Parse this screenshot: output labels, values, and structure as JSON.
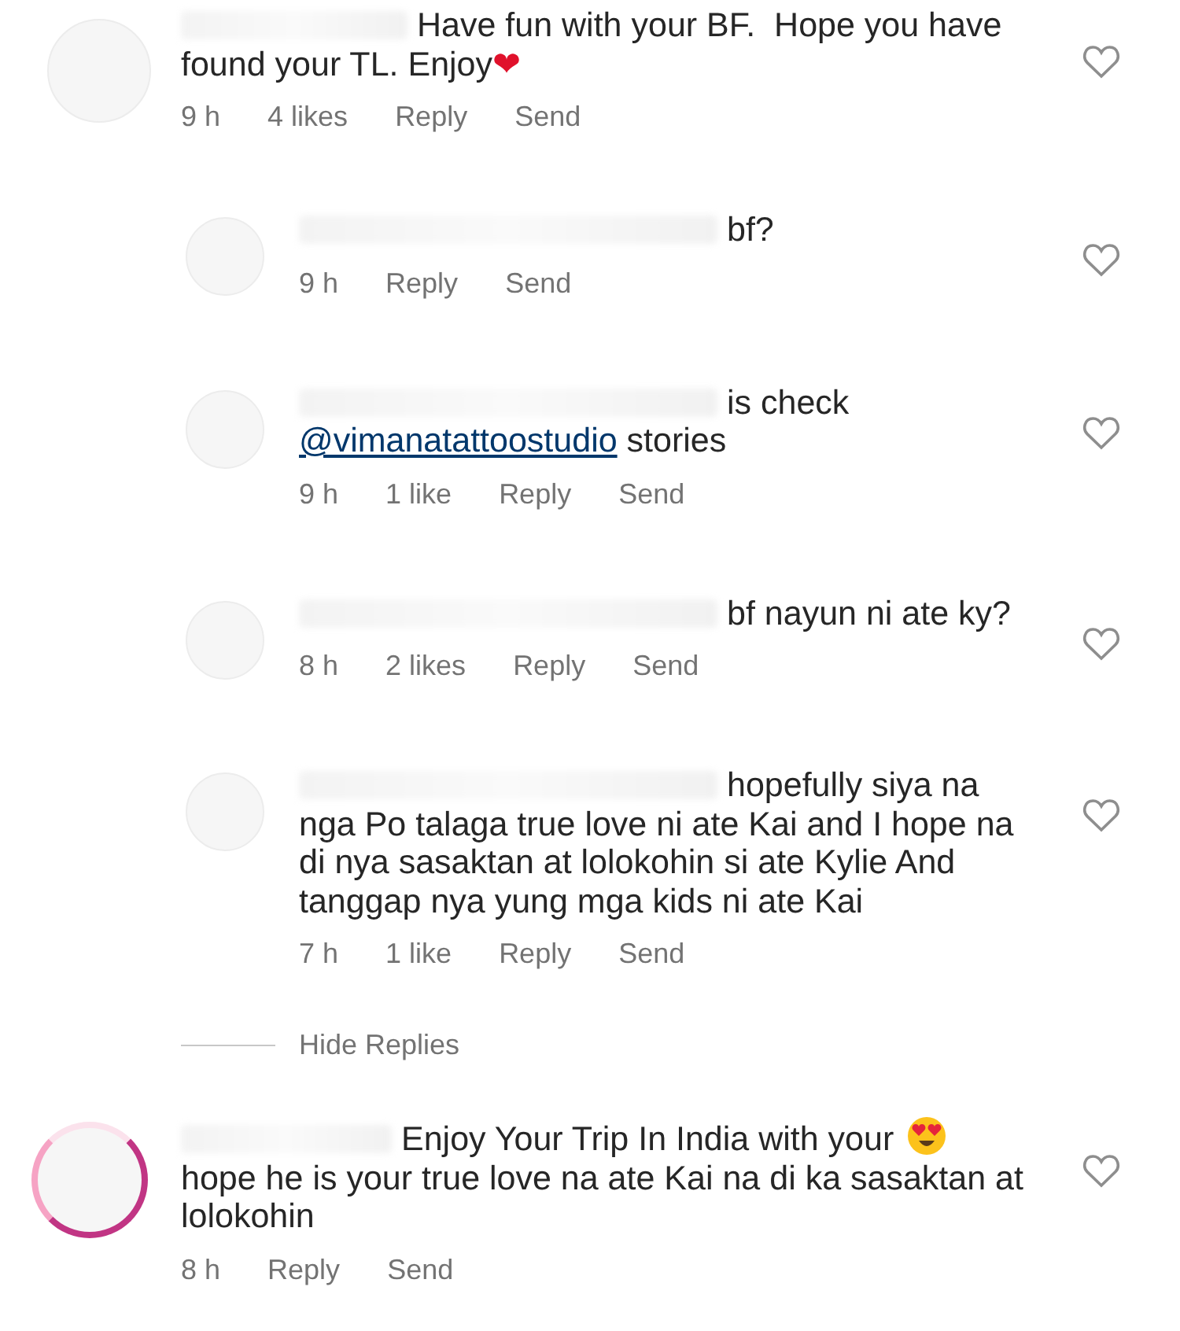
{
  "comments": [
    {
      "has_story": false,
      "liked": false,
      "text": [
        {
          "kind": "text",
          "text": "Have fun with your BF.  Hope you have found your TL. Enjoy❤"
        }
      ],
      "time": "9 h",
      "likes": "4 likes",
      "reply": "Reply",
      "send": "Send",
      "replies": [
        {
          "has_story": false,
          "liked": false,
          "text": [
            {
              "kind": "text",
              "text": "bf?"
            }
          ],
          "time": "9 h",
          "reply": "Reply",
          "send": "Send"
        },
        {
          "has_story": false,
          "liked": false,
          "text": [
            {
              "kind": "text",
              "text": "is check"
            },
            {
              "kind": "mention",
              "text": "@vimanatattoostudio"
            },
            {
              "kind": "text",
              "text": "stories"
            }
          ],
          "time": "9 h",
          "likes": "1 like",
          "reply": "Reply",
          "send": "Send"
        },
        {
          "has_story": false,
          "liked": false,
          "text": [
            {
              "kind": "text",
              "text": "bf nayun ni ate ky?"
            }
          ],
          "time": "8 h",
          "likes": "2 likes",
          "reply": "Reply",
          "send": "Send"
        },
        {
          "has_story": false,
          "liked": false,
          "text": [
            {
              "kind": "text",
              "text": "hopefully siya na nga Po talaga true love ni ate Kai and I hope na di nya sasaktan at lolokohin si ate Kylie And tanggap nya yung mga kids ni ate Kai"
            }
          ],
          "time": "7 h",
          "likes": "1 like",
          "reply": "Reply",
          "send": "Send"
        }
      ],
      "hide_replies": "Hide Replies"
    },
    {
      "has_story": true,
      "liked": false,
      "text": [
        {
          "kind": "text",
          "text": "Enjoy Your Trip In India with your"
        },
        {
          "kind": "heart-eyes-emoji"
        },
        {
          "kind": "text",
          "text": "hope he is your true love na ate Kai na di ka sasaktan at lolokohin"
        }
      ],
      "time": "8 h",
      "reply": "Reply",
      "send": "Send"
    }
  ]
}
